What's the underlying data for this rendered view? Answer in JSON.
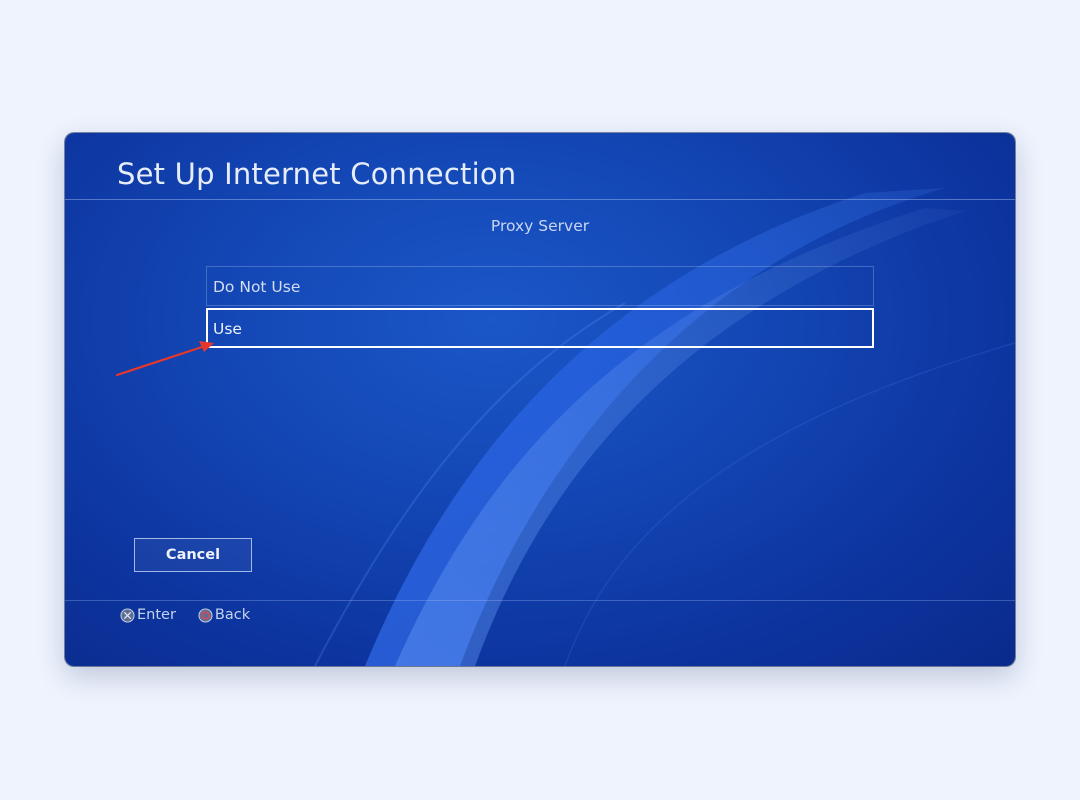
{
  "window": {
    "title": "Set Up Internet Connection"
  },
  "dialog": {
    "heading": "Proxy Server",
    "options": [
      {
        "label": "Do Not Use",
        "selected": false
      },
      {
        "label": "Use",
        "selected": true
      }
    ],
    "cancel_label": "Cancel"
  },
  "footer": {
    "enter": {
      "icon": "cross-button-icon",
      "label": "Enter"
    },
    "back": {
      "icon": "circle-button-icon",
      "label": "Back"
    }
  },
  "colors": {
    "page_background": "#eef3fd",
    "screen_blue": "#1346b4",
    "selection_border": "#ffffff",
    "annotation_arrow": "#e8362b"
  }
}
